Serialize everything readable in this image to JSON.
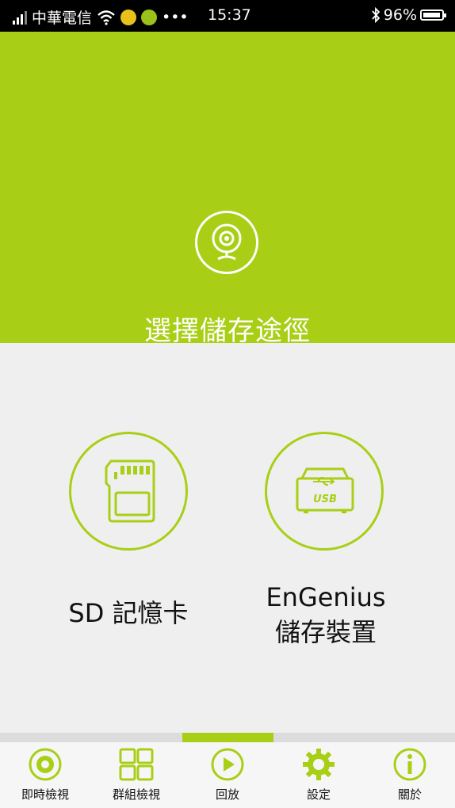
{
  "status_bar": {
    "carrier": "中華電信",
    "time": "15:37",
    "battery": "96%",
    "more": "•••",
    "icons": [
      "signal-icon",
      "wifi-icon",
      "app-notification-icon",
      "app-notification-icon",
      "bluetooth-icon",
      "battery-icon"
    ]
  },
  "header": {
    "title": "選擇儲存途徑",
    "icon": "webcam-icon"
  },
  "options": [
    {
      "label": "SD 記憶卡",
      "icon": "sd-card-icon"
    },
    {
      "label_line1": "EnGenius",
      "label_line2": "儲存裝置",
      "icon": "usb-storage-icon"
    }
  ],
  "usb_text": "USB",
  "tabs": [
    {
      "label": "即時檢視",
      "icon": "live-view-icon"
    },
    {
      "label": "群組檢視",
      "icon": "grid-view-icon"
    },
    {
      "label": "回放",
      "icon": "play-icon"
    },
    {
      "label": "設定",
      "icon": "gear-icon"
    },
    {
      "label": "關於",
      "icon": "info-icon"
    }
  ],
  "colors": {
    "accent": "#a8cf15",
    "background": "#efefef",
    "status_bar": "#000000"
  }
}
